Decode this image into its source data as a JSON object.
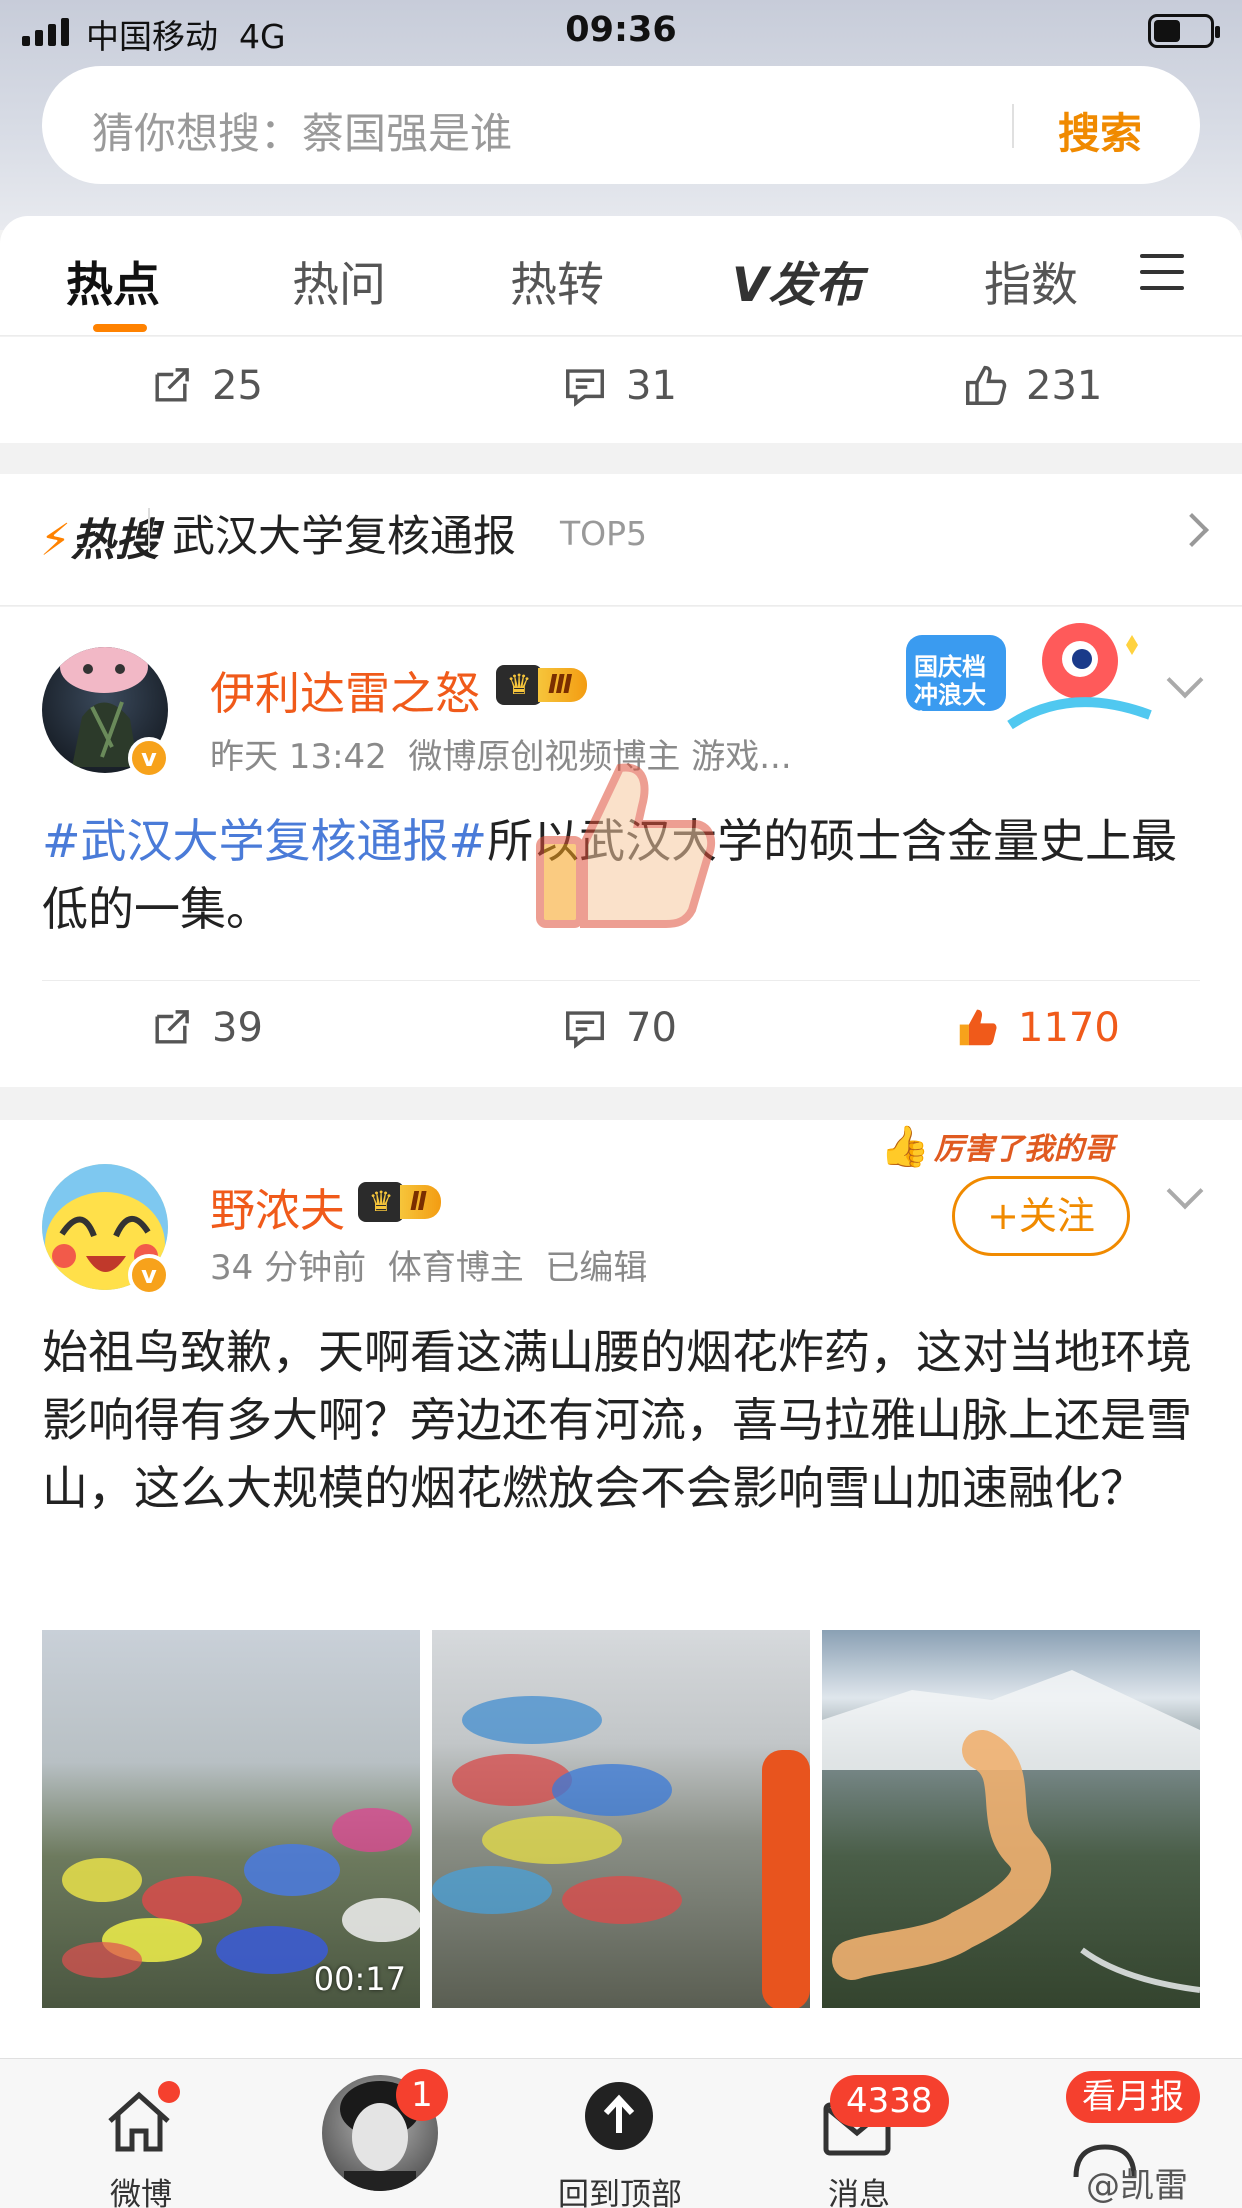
{
  "status_bar": {
    "carrier": "中国移动",
    "network": "4G",
    "time": "09:36"
  },
  "search": {
    "placeholder": "猜你想搜：蔡国强是谁",
    "button": "搜索"
  },
  "tabs": [
    {
      "label": "热点",
      "active": true
    },
    {
      "label": "热问"
    },
    {
      "label": "热转"
    },
    {
      "label": "V发布"
    },
    {
      "label": "指数"
    }
  ],
  "prev_post_actions": {
    "repost": "25",
    "comment": "31",
    "like": "231"
  },
  "hot_search": {
    "label": "热搜",
    "title": "武汉大学复核通报",
    "rank": "TOP5"
  },
  "post1": {
    "username": "伊利达雷之怒",
    "level": "Ⅲ",
    "time": "昨天 13:42",
    "bio": "微博原创视频博主 游戏...",
    "hashtag": "#武汉大学复核通报#",
    "text": "所以武汉大学的硕士含金量史上最低的一集。",
    "sticker_text": "国庆档 冲浪大师",
    "actions": {
      "repost": "39",
      "comment": "70",
      "like": "1170"
    }
  },
  "post2": {
    "username": "野浓夫",
    "level": "Ⅱ",
    "time": "34 分钟前",
    "bio": "体育博主",
    "edited": "已编辑",
    "sticker_text": "厉害了我的哥",
    "follow": "+关注",
    "text": "始祖鸟致歉，天啊看这满山腰的烟花炸药，这对当地环境影响得有多大啊？旁边还有河流，喜马拉雅山脉上还是雪山，这么大规模的烟花燃放会不会影响雪山加速融化？",
    "video_duration": "00:17"
  },
  "bottom_nav": {
    "home": "微博",
    "profile_badge": "1",
    "top": "回到顶部",
    "messages": "消息",
    "messages_badge": "4338",
    "report_badge": "看月报",
    "watermark": "@凯雷"
  },
  "colors": {
    "accent": "#ff8200",
    "link": "#4a7bd8",
    "username": "#f05a1a",
    "badge": "#f5402e"
  }
}
